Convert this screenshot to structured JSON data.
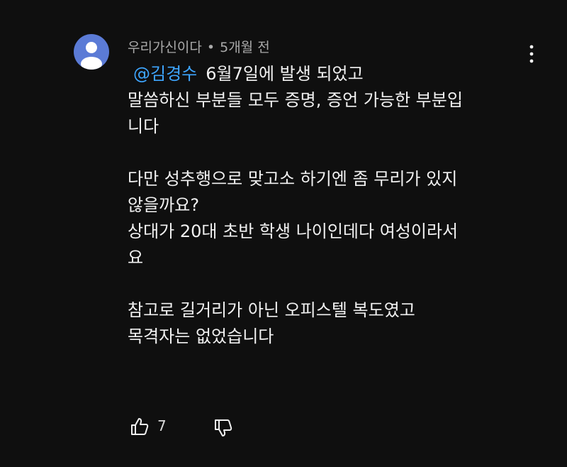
{
  "comment": {
    "author": "우리가신이다",
    "separator": "•",
    "time": "5개월 전",
    "mention": "@김경수",
    "line1": "6월7일에 발생 되었고",
    "line2": "말씀하신 부분들 모두 증명, 증언 가능한 부분입",
    "line3": "니다",
    "line4": "다만 성추행으로 맞고소 하기엔 좀 무리가 있지",
    "line5": "않을까요?",
    "line6": "상대가 20대 초반 학생 나이인데다 여성이라서",
    "line7": "요",
    "line8": "참고로 길거리가 아닌 오피스텔 복도였고",
    "line9": "목격자는 없었습니다"
  },
  "actions": {
    "like_icon": "thumbs-up-icon",
    "like_count": "7",
    "dislike_icon": "thumbs-down-icon",
    "more_icon": "more-vertical-icon"
  },
  "colors": {
    "background": "#0f0f0f",
    "mention": "#3ea6ff",
    "avatar": "#5b7bd6",
    "meta_text": "#aaaaaa"
  }
}
